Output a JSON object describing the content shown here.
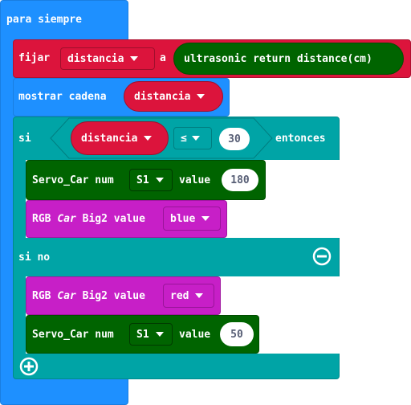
{
  "forever": {
    "label": "para siempre"
  },
  "set_block": {
    "label": "fijar",
    "variable": "distancia",
    "to": "a",
    "value": "ultrasonic return distance(cm)"
  },
  "show_block": {
    "label": "mostrar cadena",
    "value": "distancia"
  },
  "if_block": {
    "label": "si",
    "condition": {
      "left": "distancia",
      "operator": "≤",
      "right": "30"
    },
    "then": "entonces",
    "else": "si no"
  },
  "then_servo": {
    "label": "Servo_Car num",
    "servo": "S1",
    "value_label": "value",
    "value": "180"
  },
  "then_rgb": {
    "label_a": "RGB",
    "label_b": "Car",
    "label_c": "Big2 value",
    "color": "blue"
  },
  "else_rgb": {
    "label_a": "RGB",
    "label_b": "Car",
    "label_c": "Big2 value",
    "color": "red"
  },
  "else_servo": {
    "label": "Servo_Car num",
    "servo": "S1",
    "value_label": "value",
    "value": "50"
  },
  "colors": {
    "loops": "#1e90ff",
    "variables": "#dc143c",
    "logic": "#00a4a6",
    "extension_green": "#006400",
    "extension_purple": "#c71fc7"
  }
}
